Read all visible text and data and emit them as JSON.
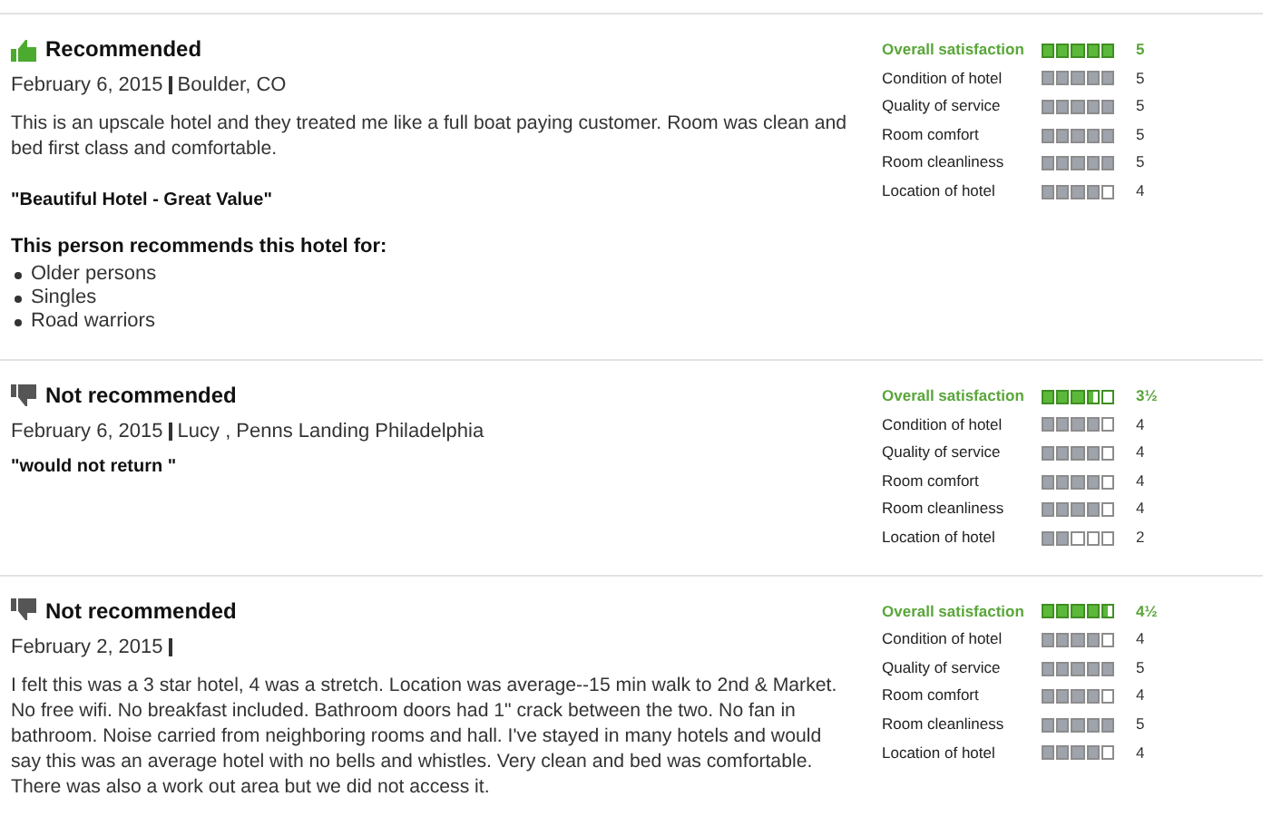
{
  "reviews": [
    {
      "recommended": true,
      "verdict": "Recommended",
      "date": "February 6, 2015",
      "author": "Boulder, CO",
      "body": "This is an upscale hotel and they treated me like a full boat paying customer. Room was clean and bed first class and comfortable.",
      "quote": "\"Beautiful Hotel - Great Value\"",
      "recommends_heading": "This person recommends this hotel for:",
      "recommends_for": [
        "Older persons",
        "Singles",
        "Road warriors"
      ],
      "ratings": [
        {
          "kind": "overall",
          "label": "Overall satisfaction",
          "stars": 5,
          "score": "5"
        },
        {
          "kind": "aspect",
          "label": "Condition of hotel",
          "stars": 5,
          "score": "5"
        },
        {
          "kind": "aspect",
          "label": "Quality of service",
          "stars": 5,
          "score": "5"
        },
        {
          "kind": "aspect",
          "label": "Room comfort",
          "stars": 5,
          "score": "5"
        },
        {
          "kind": "aspect",
          "label": "Room cleanliness",
          "stars": 5,
          "score": "5"
        },
        {
          "kind": "aspect",
          "label": "Location of hotel",
          "stars": 4,
          "score": "4"
        }
      ]
    },
    {
      "recommended": false,
      "verdict": "Not recommended",
      "date": "February 6, 2015",
      "author": "Lucy , Penns Landing Philadelphia",
      "quote": "\"would not return \"",
      "ratings": [
        {
          "kind": "overall",
          "label": "Overall satisfaction",
          "stars": 3.5,
          "score": "3½"
        },
        {
          "kind": "aspect",
          "label": "Condition of hotel",
          "stars": 4,
          "score": "4"
        },
        {
          "kind": "aspect",
          "label": "Quality of service",
          "stars": 4,
          "score": "4"
        },
        {
          "kind": "aspect",
          "label": "Room comfort",
          "stars": 4,
          "score": "4"
        },
        {
          "kind": "aspect",
          "label": "Room cleanliness",
          "stars": 4,
          "score": "4"
        },
        {
          "kind": "aspect",
          "label": "Location of hotel",
          "stars": 2,
          "score": "2"
        }
      ]
    },
    {
      "recommended": false,
      "verdict": "Not recommended",
      "date": "February 2, 2015",
      "body": "I felt this was a 3 star hotel, 4 was a stretch. Location was average--15 min walk to 2nd & Market. No free wifi. No breakfast included. Bathroom doors had 1\" crack between the two. No fan in bathroom. Noise carried from neighboring rooms and hall. I've stayed in many hotels and would say this was an average hotel with no bells and whistles. Very clean and bed was comfortable. There was also a work out area but we did not access it.",
      "ratings": [
        {
          "kind": "overall",
          "label": "Overall satisfaction",
          "stars": 4.5,
          "score": "4½"
        },
        {
          "kind": "aspect",
          "label": "Condition of hotel",
          "stars": 4,
          "score": "4"
        },
        {
          "kind": "aspect",
          "label": "Quality of service",
          "stars": 5,
          "score": "5"
        },
        {
          "kind": "aspect",
          "label": "Room comfort",
          "stars": 4,
          "score": "4"
        },
        {
          "kind": "aspect",
          "label": "Room cleanliness",
          "stars": 5,
          "score": "5"
        },
        {
          "kind": "aspect",
          "label": "Location of hotel",
          "stars": 4,
          "score": "4"
        }
      ]
    }
  ]
}
